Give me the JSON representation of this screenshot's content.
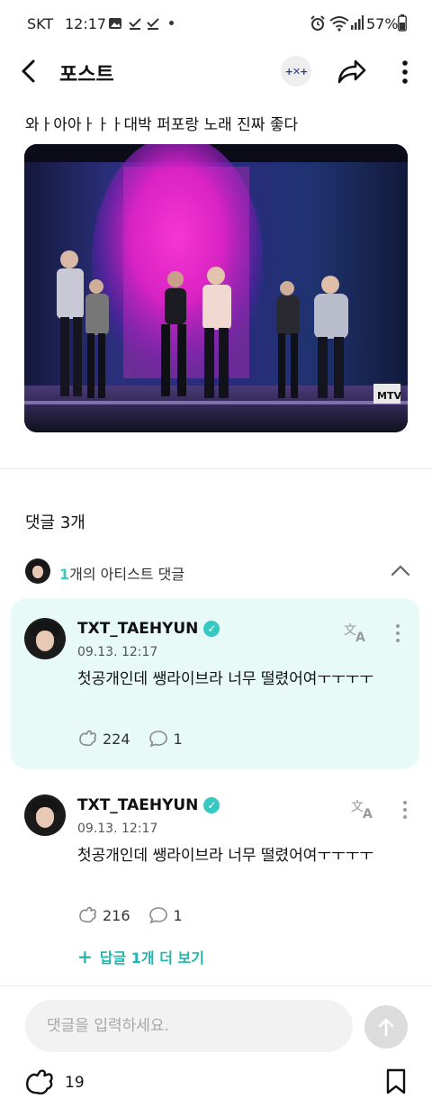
{
  "status_bar": {
    "carrier": "SKT",
    "time": "12:17",
    "battery": "57%"
  },
  "header": {
    "title": "포스트",
    "community_logo_text": "+✕+"
  },
  "post": {
    "text": "와ㅏ아아ㅏㅏㅏ대박 퍼포랑 노래 진짜 좋다",
    "image_watermark": "MTV"
  },
  "comments_section": {
    "title": "댓글 3개",
    "artist_bar": {
      "count": "1",
      "label": "개의 아티스트 댓글"
    },
    "comments": [
      {
        "author": "TXT_TAEHYUN",
        "date": "09.13. 12:17",
        "text": "첫공개인데 쌩라이브라 너무 떨렸어여ㅜㅜㅜㅜ",
        "likes": "224",
        "replies": "1",
        "highlighted": true
      },
      {
        "author": "TXT_TAEHYUN",
        "date": "09.13. 12:17",
        "text": "첫공개인데 쌩라이브라 너무 떨렸어여ㅜㅜㅜㅜ",
        "likes": "216",
        "replies": "1",
        "more_replies_label": "답글 1개 더 보기"
      }
    ]
  },
  "composer": {
    "placeholder": "댓글을 입력하세요."
  },
  "bottom_bar": {
    "like_count": "19"
  },
  "colors": {
    "accent": "#36c9c1",
    "highlight_bg": "#e7faf7"
  }
}
